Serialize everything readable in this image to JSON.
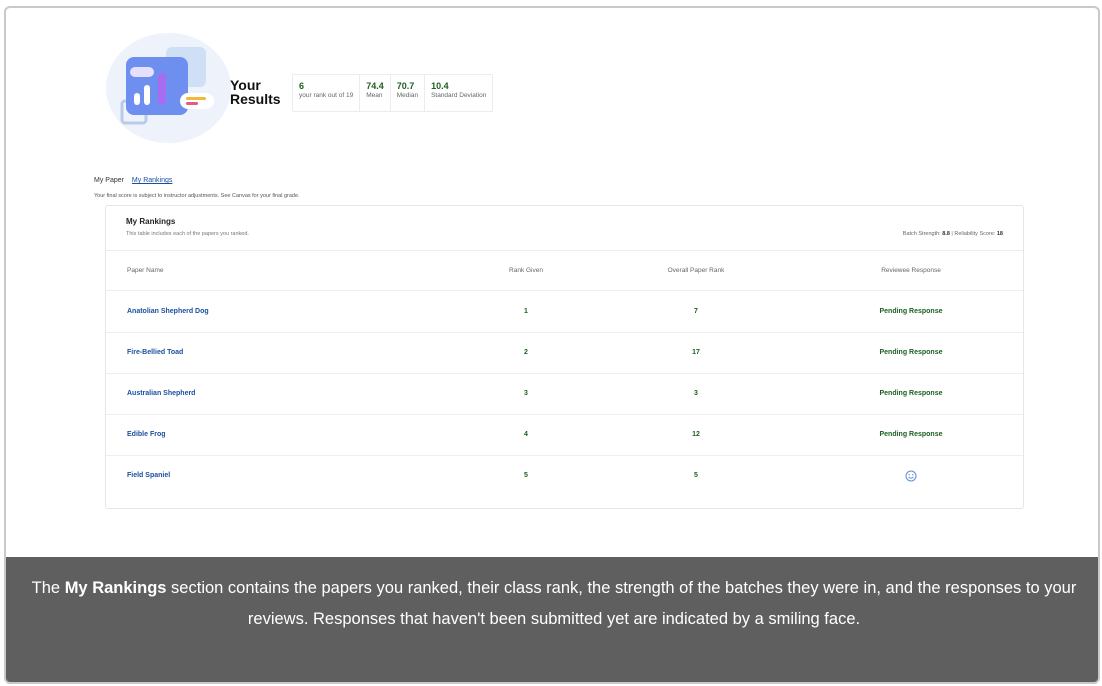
{
  "header": {
    "title_line1": "Your",
    "title_line2": "Results",
    "stats": [
      {
        "value": "6",
        "label": "your rank out of 19"
      },
      {
        "value": "74.4",
        "label": "Mean"
      },
      {
        "value": "70.7",
        "label": "Median"
      },
      {
        "value": "10.4",
        "label": "Standard Deviation"
      }
    ]
  },
  "tabs": {
    "my_paper": "My Paper",
    "my_rankings": "My Rankings"
  },
  "note": "Your final score is subject to instructor adjustments. See Canvas for your final grade.",
  "card": {
    "title": "My Rankings",
    "subtitle": "This table includes each of the papers you ranked.",
    "batch_label": "Batch Strength:",
    "batch_value": "8.8",
    "reliability_label": "| Reliability Score:",
    "reliability_value": "18"
  },
  "table": {
    "columns": [
      "Paper Name",
      "Rank Given",
      "Overall Paper Rank",
      "Reviewee Response"
    ],
    "rows": [
      {
        "name": "Anatolian Shepherd Dog",
        "given": "1",
        "overall": "7",
        "response": "Pending Response"
      },
      {
        "name": "Fire-Bellied Toad",
        "given": "2",
        "overall": "17",
        "response": "Pending Response"
      },
      {
        "name": "Australian Shepherd",
        "given": "3",
        "overall": "3",
        "response": "Pending Response"
      },
      {
        "name": "Edible Frog",
        "given": "4",
        "overall": "12",
        "response": "Pending Response"
      },
      {
        "name": "Field Spaniel",
        "given": "5",
        "overall": "5",
        "response": "",
        "response_icon": "smiley-icon"
      }
    ]
  },
  "caption": {
    "pre": "The ",
    "bold": "My Rankings",
    "post": " section contains the papers you ranked, their class rank, the strength of the batches they were in, and the responses to your reviews. Responses that haven't been submitted yet are indicated by a smiling face."
  },
  "colors": {
    "accent_link": "#1a4fa0",
    "value_green": "#1b5e20",
    "caption_bg": "#5f5f5f"
  }
}
